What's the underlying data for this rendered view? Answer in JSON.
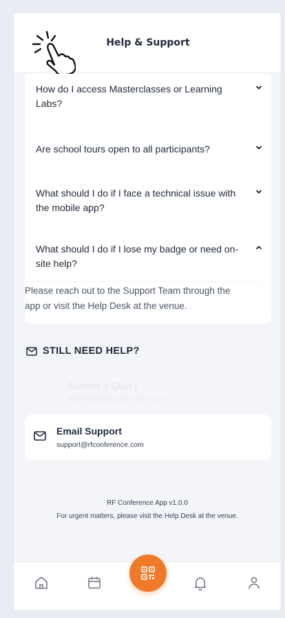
{
  "header": {
    "title": "Help & Support"
  },
  "faq": [
    {
      "question": "How do I access Masterclasses or Learning Labs?",
      "expanded": false
    },
    {
      "question": "Are school tours open to all participants?",
      "expanded": false
    },
    {
      "question": "What should I do if I face a technical issue with the mobile app?",
      "expanded": false
    },
    {
      "question": "What should I do if I lose my badge or need on-site help?",
      "expanded": true,
      "answer": "Please reach out to the Support Team through the app or visit the Help Desk at the venue."
    }
  ],
  "still_need_help": {
    "label": "STILL NEED HELP?"
  },
  "submit_query": {
    "title": "Submit a Query",
    "subtitle": "We'll respond within 24 hours"
  },
  "email_support": {
    "title": "Email Support",
    "address": "support@rfconference.com"
  },
  "footer": {
    "version": "RF Conference App v1.0.0",
    "note": "For urgent matters, please visit the Help Desk at the venue."
  },
  "nav": {
    "items": [
      "home-icon",
      "calendar-icon",
      "qr-code-icon",
      "bell-icon",
      "user-icon"
    ],
    "accent": "#f07a2a"
  }
}
